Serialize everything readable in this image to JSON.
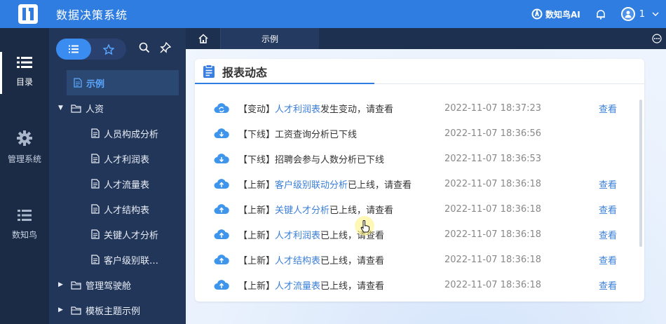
{
  "app": {
    "title": "数据决策系统"
  },
  "header": {
    "ai_label": "数知鸟AI",
    "user_name": "1",
    "icons": [
      "app-logo",
      "ai-icon",
      "bell-icon",
      "user-avatar-icon",
      "chevron-down-icon"
    ]
  },
  "rail": {
    "items": [
      {
        "label": "目录",
        "icon": "list-icon",
        "active": true
      },
      {
        "label": "管理系统",
        "icon": "gear-icon",
        "active": false
      },
      {
        "label": "数知鸟",
        "icon": "list-icon",
        "active": false
      }
    ]
  },
  "tree": {
    "tools": [
      "list-view-icon",
      "favorites-star-icon",
      "search-icon",
      "pin-icon"
    ],
    "items": [
      {
        "label": "示例",
        "level": 0,
        "type": "report",
        "selected": true
      },
      {
        "label": "人资",
        "level": 0,
        "type": "folder",
        "expanded": true
      },
      {
        "label": "人员构成分析",
        "level": 1,
        "type": "report"
      },
      {
        "label": "人才利润表",
        "level": 1,
        "type": "report"
      },
      {
        "label": "人才流量表",
        "level": 1,
        "type": "report"
      },
      {
        "label": "人才结构表",
        "level": 1,
        "type": "report"
      },
      {
        "label": "关键人才分析",
        "level": 1,
        "type": "report"
      },
      {
        "label": "客户级别联…",
        "level": 1,
        "type": "report"
      },
      {
        "label": "管理驾驶舱",
        "level": 0,
        "type": "folder",
        "expanded": false
      },
      {
        "label": "模板主题示例",
        "level": 0,
        "type": "folder",
        "expanded": false
      }
    ]
  },
  "tabs": {
    "home_icon": "home-icon",
    "active_label": "示例",
    "more_icon": "more-icon"
  },
  "card": {
    "title": "报表动态",
    "view_label": "查看",
    "rows": [
      {
        "icon": "cloud-sync-icon",
        "prefix": "【变动】",
        "link": "人才利润表",
        "suffix": "发生变动，请查看",
        "time": "2022-11-07 18:37:23",
        "viewable": true
      },
      {
        "icon": "cloud-download-icon",
        "prefix": "【下线】",
        "link": "",
        "suffix": "工资查询分析已下线",
        "time": "2022-11-07 18:36:56",
        "viewable": false
      },
      {
        "icon": "cloud-download-icon",
        "prefix": "【下线】",
        "link": "",
        "suffix": "招聘会参与人数分析已下线",
        "time": "2022-11-07 18:36:53",
        "viewable": false
      },
      {
        "icon": "cloud-upload-icon",
        "prefix": "【上新】",
        "link": "客户级别联动分析",
        "suffix": "已上线，请查看",
        "time": "2022-11-07 18:36:18",
        "viewable": true
      },
      {
        "icon": "cloud-upload-icon",
        "prefix": "【上新】",
        "link": "关键人才分析",
        "suffix": "已上线，请查看",
        "time": "2022-11-07 18:36:18",
        "viewable": true
      },
      {
        "icon": "cloud-upload-icon",
        "prefix": "【上新】",
        "link": "人才利润表",
        "suffix": "已上线，请查看",
        "time": "2022-11-07 18:36:18",
        "viewable": true
      },
      {
        "icon": "cloud-upload-icon",
        "prefix": "【上新】",
        "link": "人才结构表",
        "suffix": "已上线，请查看",
        "time": "2022-11-07 18:36:18",
        "viewable": true
      },
      {
        "icon": "cloud-upload-icon",
        "prefix": "【上新】",
        "link": "人才流量表",
        "suffix": "已上线，请查看",
        "time": "2022-11-07 18:36:18",
        "viewable": true
      }
    ]
  },
  "colors": {
    "primary": "#2f7de1",
    "rail_bg": "#1b2a45",
    "tree_bg": "#22365a",
    "link": "#3a7fd8"
  }
}
